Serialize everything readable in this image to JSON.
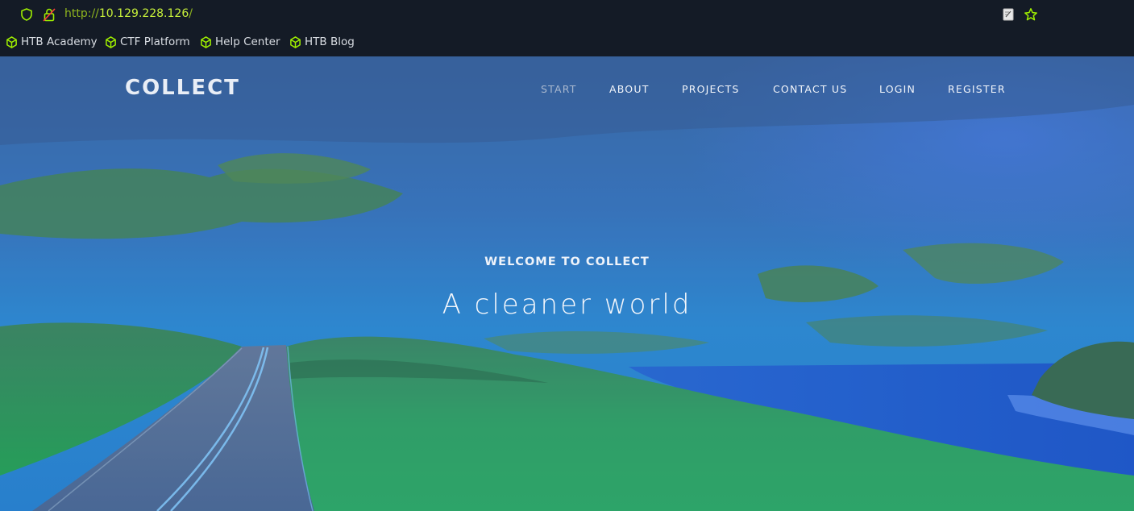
{
  "browser": {
    "url_scheme": "http://",
    "url_host": "10.129.228.126",
    "url_path": "/",
    "bookmarks": [
      {
        "label": "HTB Academy"
      },
      {
        "label": "CTF Platform"
      },
      {
        "label": "Help Center"
      },
      {
        "label": "HTB Blog"
      }
    ]
  },
  "site": {
    "brand": "COLLECT",
    "nav": [
      {
        "label": "START",
        "active": true
      },
      {
        "label": "ABOUT"
      },
      {
        "label": "PROJECTS"
      },
      {
        "label": "CONTACT US"
      },
      {
        "label": "LOGIN"
      },
      {
        "label": "REGISTER"
      }
    ],
    "hero": {
      "welcome": "WELCOME TO COLLECT",
      "tagline": "A cleaner world"
    }
  },
  "colors": {
    "browser_bg": "#141b26",
    "url_green": "#c7f03a",
    "bookmark_icon": "#9fef00"
  },
  "icons": [
    "shield-icon",
    "lock-insecure-icon",
    "page-action-icon",
    "bookmark-star-icon",
    "htb-cube-icon"
  ]
}
